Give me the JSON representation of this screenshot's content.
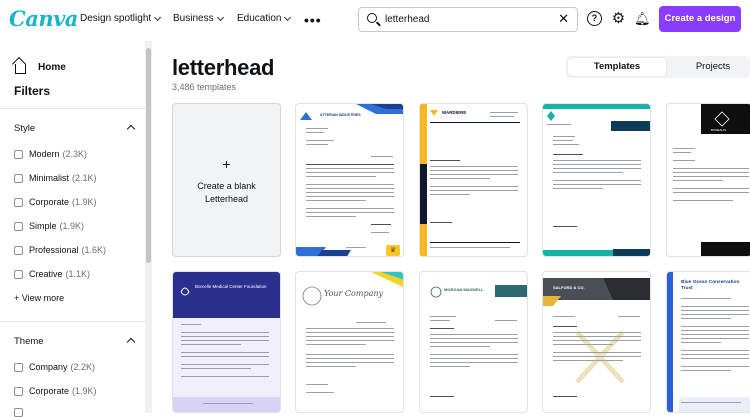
{
  "brand": {
    "logo": "Canva",
    "accent": "#8b3dff",
    "logo_color": "#1ab4c9"
  },
  "nav": [
    {
      "label": "Design spotlight"
    },
    {
      "label": "Business"
    },
    {
      "label": "Education"
    }
  ],
  "search": {
    "value": "letterhead"
  },
  "topbar": {
    "cta_label": "Create a design",
    "icons": [
      "help-icon",
      "gear-icon",
      "bell-icon",
      "more-icon"
    ]
  },
  "sidebar": {
    "home_label": "Home",
    "filters_title": "Filters",
    "style": {
      "title": "Style",
      "items": [
        {
          "label": "Modern",
          "count": "(2.3K)"
        },
        {
          "label": "Minimalist",
          "count": "(2.1K)"
        },
        {
          "label": "Corporate",
          "count": "(1.9K)"
        },
        {
          "label": "Simple",
          "count": "(1.9K)"
        },
        {
          "label": "Professional",
          "count": "(1.6K)"
        },
        {
          "label": "Creative",
          "count": "(1.1K)"
        }
      ],
      "view_more": "View more"
    },
    "theme": {
      "title": "Theme",
      "items": [
        {
          "label": "Company",
          "count": "(2.2K)"
        },
        {
          "label": "Corporate",
          "count": "(1.9K)"
        }
      ]
    }
  },
  "main": {
    "title": "letterhead",
    "count": "3,486 templates",
    "tabs": [
      {
        "label": "Templates"
      },
      {
        "label": "Projects"
      }
    ],
    "blank_label": "Create a blank Letterhead",
    "template_texts": {
      "t1_company": "ATTERIAN INDUSTRIES",
      "t2_company": "WARDIERE",
      "t5_company": "BOREALIS",
      "t6_company": "Borcelle Medical Center Foundation",
      "t7_company": "Your Company",
      "t8_company": "MORGAN MAXWELL",
      "t9_company": "SALFORD & CO.",
      "t10_company": "Blue Ocean Conservation Trust"
    }
  }
}
